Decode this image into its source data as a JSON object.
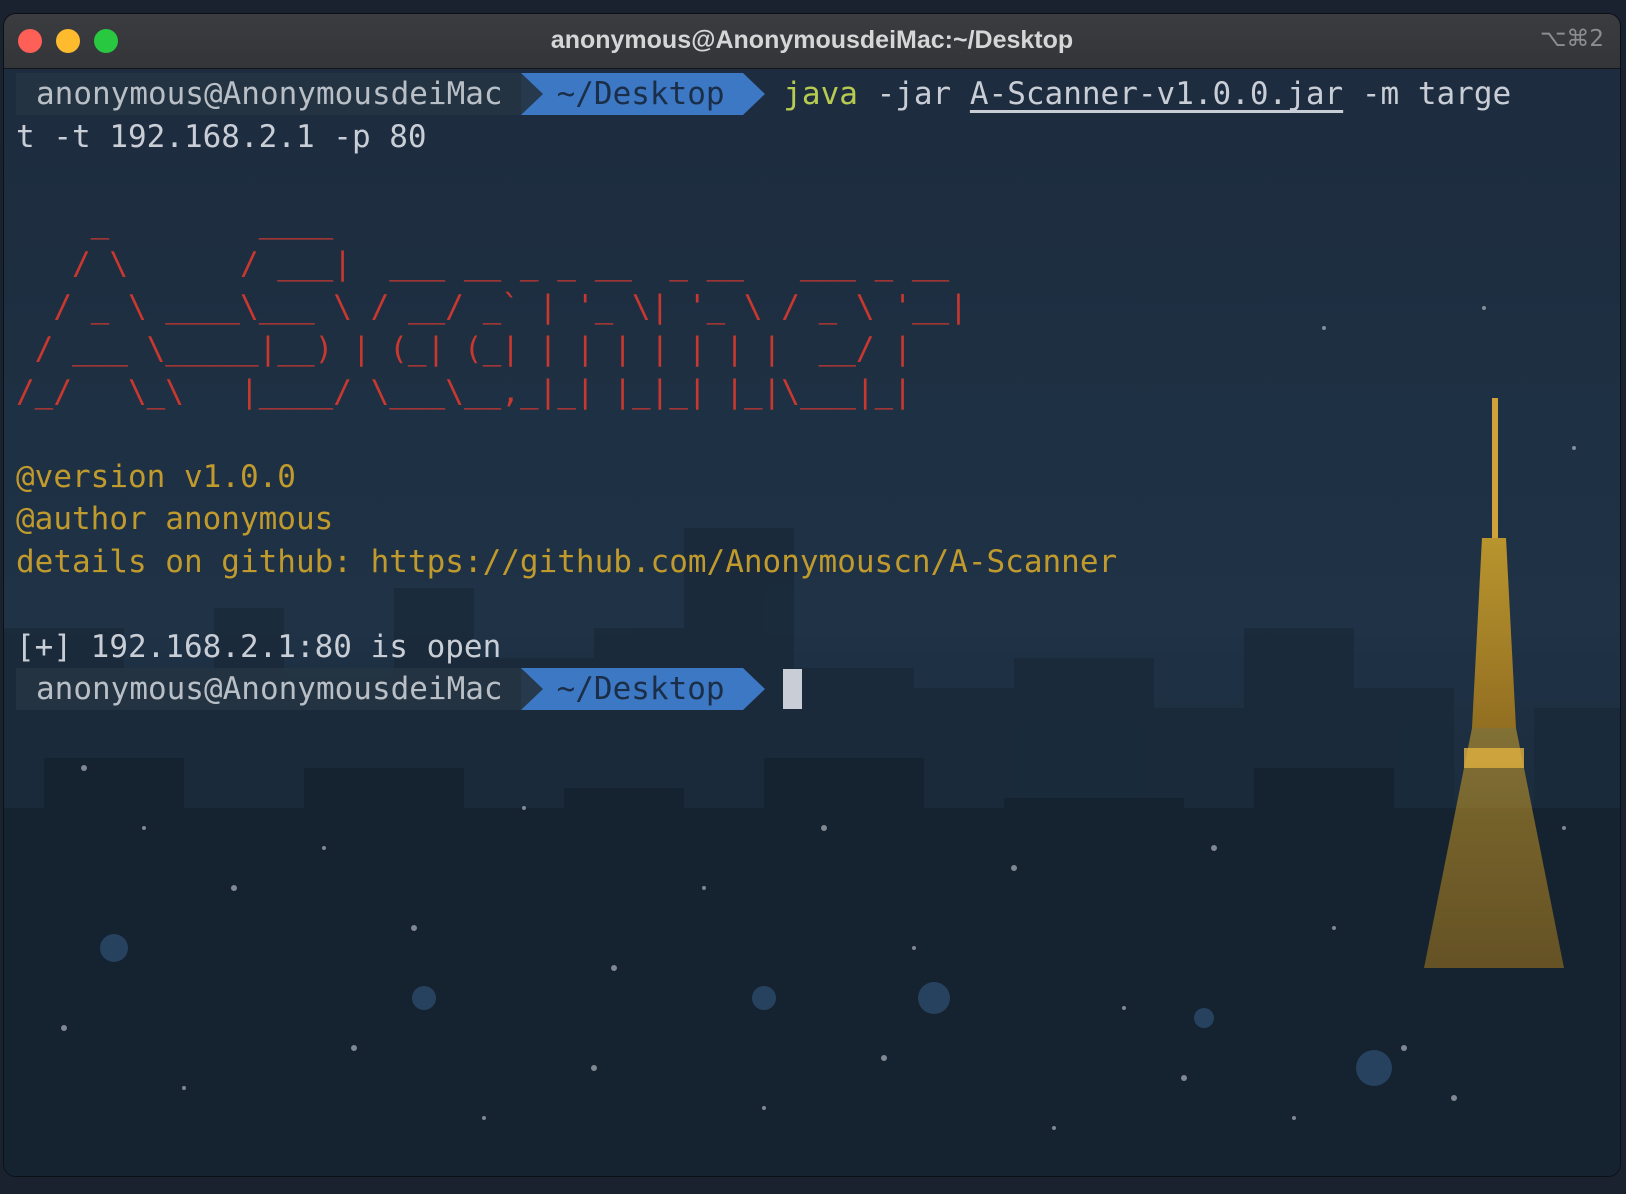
{
  "window": {
    "title": "anonymous@AnonymousdeiMac:~/Desktop",
    "shortcut": "⌥⌘2",
    "colors": {
      "close": "#fe5f57",
      "minimize": "#febb2e",
      "maximize": "#28c840"
    }
  },
  "prompt": {
    "user": "anonymous@AnonymousdeiMac",
    "dir": "~/Desktop",
    "user_bg": "#243442",
    "dir_bg": "#3d78c4"
  },
  "command": {
    "program": "java",
    "args_before_jar": " -jar ",
    "jar": "A-Scanner-v1.0.0.jar",
    "args_after_jar_line1": " -m targe",
    "line2": "t -t 192.168.2.1 -p 80"
  },
  "banner": {
    "color": "#c9382f",
    "lines": [
      "    _        ____",
      "   / \\      / ___|  ___ __ _ _ __  _ __   ___ _ __",
      "  / _ \\ ____\\___ \\ / __/ _` | '_ \\| '_ \\ / _ \\ '__|",
      " / ___ \\_____|__) | (_| (_| | | | | | | |  __/ |",
      "/_/   \\_\\   |____/ \\___\\__,_|_| |_|_| |_|\\___|_|"
    ]
  },
  "info": {
    "color": "#c09a2c",
    "version": "@version v1.0.0",
    "author": "@author anonymous",
    "details": "details on github: https://github.com/Anonymouscn/A-Scanner"
  },
  "result": {
    "text": "[+] 192.168.2.1:80 is open"
  },
  "background": {
    "description_icon": "city-night-skyline"
  }
}
